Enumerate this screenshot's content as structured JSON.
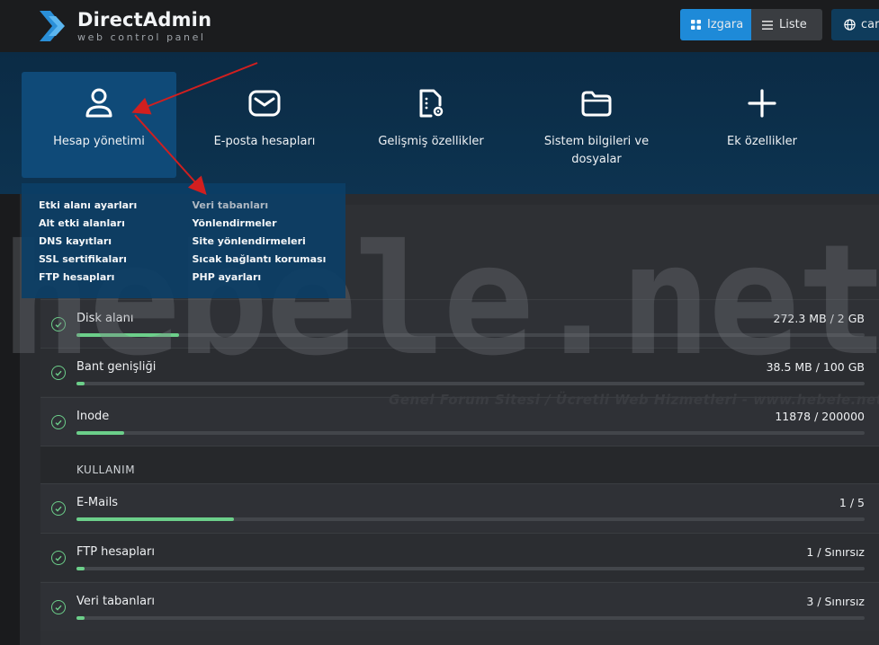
{
  "app": {
    "title": "DirectAdmin",
    "subtitle": "web control panel"
  },
  "toolbar": {
    "grid_label": "Izgara",
    "list_label": "Liste",
    "lang_label": "car"
  },
  "nav": {
    "items": [
      {
        "label": "Hesap yönetimi",
        "icon": "user-icon",
        "active": true
      },
      {
        "label": "E-posta hesapları",
        "icon": "envelope-icon"
      },
      {
        "label": "Gelişmiş özellikler",
        "icon": "settings-file-icon"
      },
      {
        "label": "Sistem bilgileri ve dosyalar",
        "icon": "folder-icon"
      },
      {
        "label": "Ek özellikler",
        "icon": "plus-icon"
      }
    ]
  },
  "dropdown": {
    "left": [
      "Etki alanı ayarları",
      "Alt etki alanları",
      "DNS kayıtları",
      "SSL sertifikaları",
      "FTP hesapları"
    ],
    "right": [
      "Veri tabanları",
      "Yönlendirmeler",
      "Site yönlendirmeleri",
      "Sıcak bağlantı koruması",
      "PHP ayarları"
    ]
  },
  "resources": [
    {
      "label": "Disk alanı",
      "value": "272.3 MB / 2 GB",
      "fraction": 0.13
    },
    {
      "label": "Bant genişliği",
      "value": "38.5 MB / 100 GB",
      "fraction": 0.01
    },
    {
      "label": "Inode",
      "value": "11878 / 200000",
      "fraction": 0.06
    }
  ],
  "usage_section": {
    "title": "KULLANIM"
  },
  "usage": [
    {
      "label": "E-Mails",
      "value": "1 / 5",
      "fraction": 0.2
    },
    {
      "label": "FTP hesapları",
      "value": "1 / Sınırsız",
      "fraction": 0.01
    },
    {
      "label": "Veri tabanları",
      "value": "3 / Sınırsız",
      "fraction": 0.01
    }
  ],
  "watermark": {
    "main": "hebele.net",
    "sub": "Genel Forum Sitesi / Ücretli Web Hizmetleri - www.hebele.net"
  },
  "colors": {
    "accent": "#1e8ad8",
    "menu_band": "#0d3350",
    "active_tab": "#0f4a78",
    "progress": "#6ccf8a",
    "annotation_arrow": "#d11f1f"
  }
}
